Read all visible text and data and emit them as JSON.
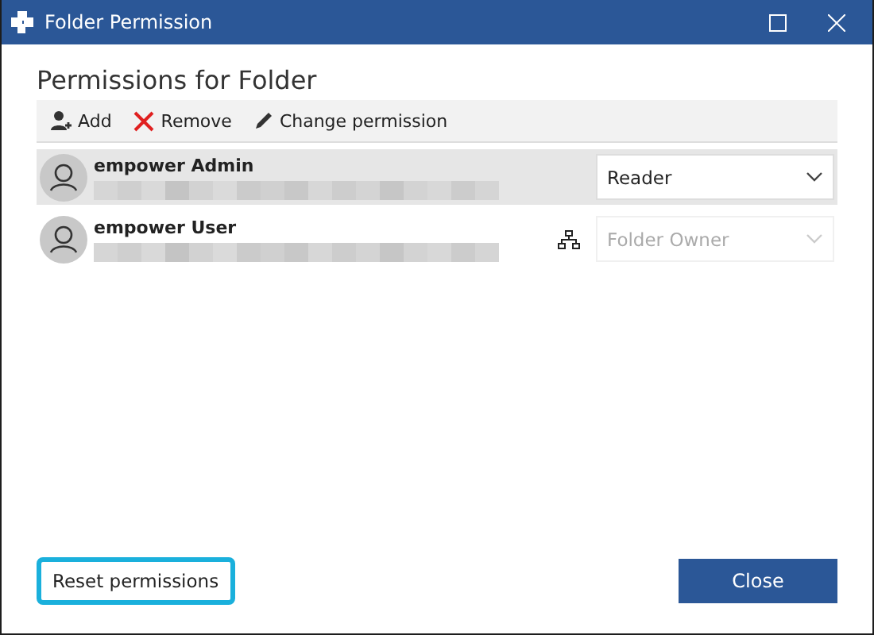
{
  "window": {
    "title": "Folder Permission"
  },
  "heading": "Permissions for Folder",
  "toolbar": [
    {
      "kind": "add",
      "label": "Add"
    },
    {
      "kind": "remove",
      "label": "Remove"
    },
    {
      "kind": "edit",
      "label": "Change permission"
    }
  ],
  "users": [
    {
      "name": "empower Admin",
      "selected": true,
      "inherited": false,
      "disabled": false,
      "permission": "Reader"
    },
    {
      "name": "empower User",
      "selected": false,
      "inherited": true,
      "disabled": true,
      "permission": "Folder Owner"
    }
  ],
  "buttons": {
    "reset": {
      "label": "Reset permissions",
      "focused": true
    },
    "close": {
      "label": "Close"
    }
  }
}
